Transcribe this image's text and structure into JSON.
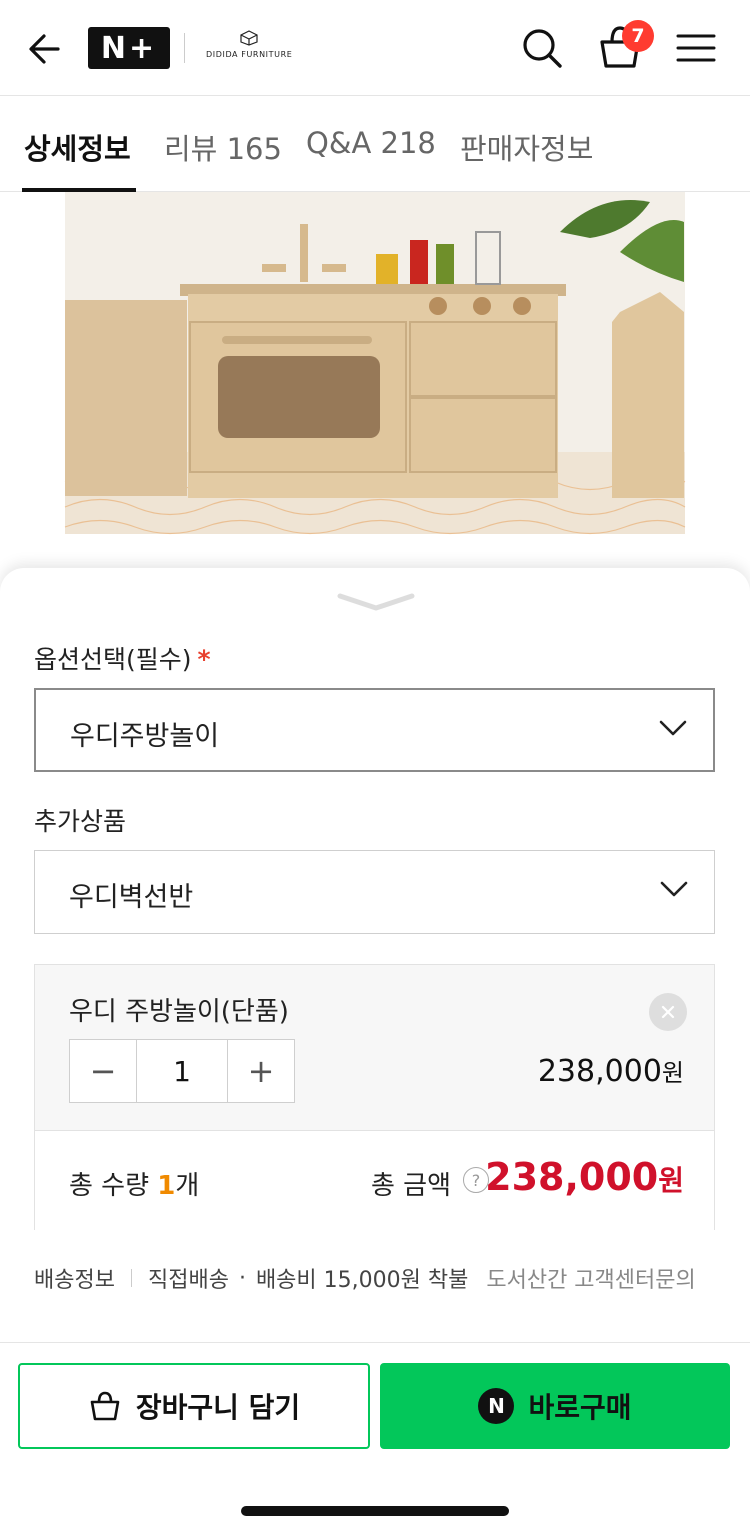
{
  "header": {
    "brand_np": "N+",
    "brand_partner": "DIDIDA FURNITURE",
    "cart_count": "7",
    "icons": [
      "back-arrow-icon",
      "search-icon",
      "shopping-bag-icon",
      "hamburger-menu-icon"
    ]
  },
  "tabs": [
    {
      "label": "상세정보",
      "active": true
    },
    {
      "label": "리뷰 165",
      "active": false
    },
    {
      "label": "Q&A 218",
      "active": false
    },
    {
      "label": "판매자정보",
      "active": false
    }
  ],
  "product_image": {
    "alt": "wooden play kitchen photo"
  },
  "sheet": {
    "option_label": "옵션선택(필수)",
    "required_mark": "*",
    "option_value": "우디주방놀이",
    "addon_label": "추가상품",
    "addon_value": "우디벽선반",
    "selected_item": {
      "name": "우디 주방놀이(단품)",
      "quantity": "1",
      "minus": "−",
      "plus": "+",
      "price": "238,000",
      "price_unit": "원"
    },
    "total": {
      "qty_prefix": "총 수량 ",
      "qty_num": "1",
      "qty_suffix": "개",
      "amount_label": "총 금액",
      "help": "?",
      "amount": "238,000",
      "amount_unit": "원"
    },
    "shipping": {
      "label": "배송정보",
      "method": "직접배송",
      "dot": "·",
      "fee": "배송비 15,000원 착불",
      "extra": "도서산간 고객센터문의"
    }
  },
  "actions": {
    "cart_button": "장바구니 담기",
    "buy_button": "바로구매",
    "npay_mark": "N"
  },
  "colors": {
    "accent_green": "#03c75a",
    "price_red": "#d0112b",
    "qty_orange": "#f08a00",
    "badge_red": "#ff3b30"
  }
}
